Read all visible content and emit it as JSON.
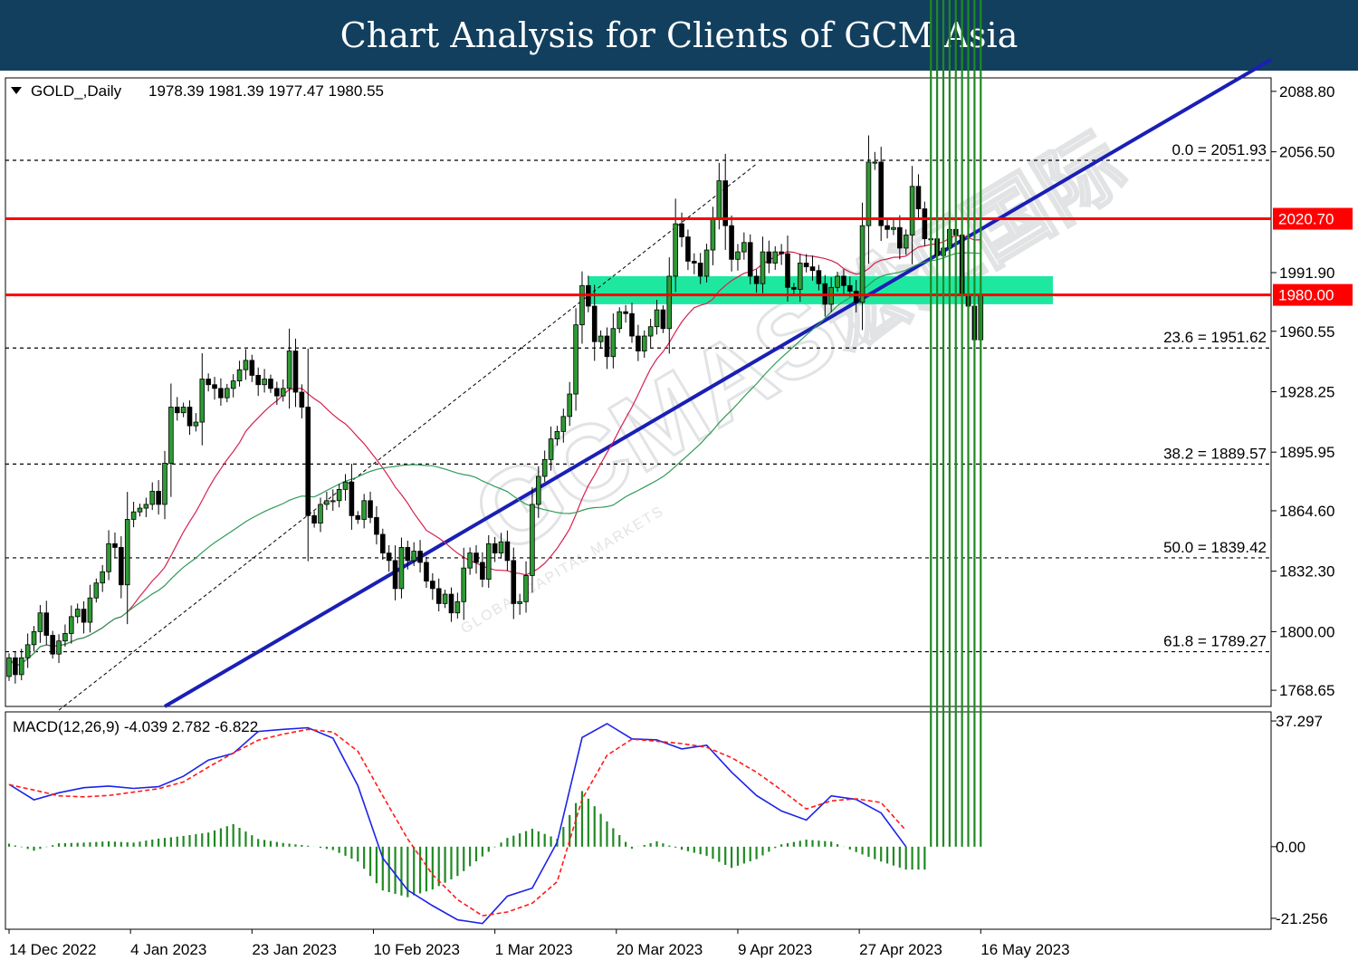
{
  "banner": {
    "title": "Chart Analysis for Clients of GCM Asia"
  },
  "watermark": {
    "brand": "GCMASIA",
    "chinese": "宏汇国际",
    "tagline": "GLOBAL CAPITAL MARKETS"
  },
  "colors": {
    "banner_bg": "#123f5e",
    "bull_candle": "#2e9a34",
    "bear_candle": "#000000",
    "ma_short": "#d8204f",
    "ma_long": "#2f9a58",
    "resistance": "#ff0000",
    "trendline": "#1a1fb5",
    "zone": "#1ee8a0",
    "macd_line": "#1b22e8",
    "macd_signal": "#ff1a1a",
    "macd_hist": "#1f8a22"
  },
  "chart_data": {
    "type": "candlestick",
    "symbol_header": "GOLD_,Daily",
    "ohlc_header": "1978.39 1981.39 1977.47 1980.55",
    "main_panel": {
      "ylim": [
        1760.0,
        2096.0
      ],
      "y_ticks": [
        "2088.80",
        "2056.50",
        "1991.90",
        "1960.55",
        "1928.25",
        "1895.95",
        "1864.60",
        "1832.30",
        "1800.00",
        "1768.65"
      ],
      "x_ticks": [
        "14 Dec 2022",
        "4 Jan 2023",
        "23 Jan 2023",
        "10 Feb 2023",
        "1 Mar 2023",
        "20 Mar 2023",
        "9 Apr 2023",
        "27 Apr 2023",
        "16 May 2023"
      ],
      "price_levels": [
        {
          "label": "2020.70",
          "value": 2020.7,
          "style": "solid-red"
        },
        {
          "label": "1980.00",
          "value": 1980.0,
          "style": "solid-red"
        }
      ],
      "fibonacci": [
        {
          "label": "0.0 = 2051.93",
          "value": 2051.93
        },
        {
          "label": "23.6 = 1951.62",
          "value": 1951.62
        },
        {
          "label": "38.2 = 1889.57",
          "value": 1889.57
        },
        {
          "label": "50.0 = 1839.42",
          "value": 1839.42
        },
        {
          "label": "61.8 = 1789.27",
          "value": 1789.27
        }
      ],
      "support_zone": [
        1975.0,
        1990.0
      ],
      "uptrend_line": [
        [
          25,
          1760
        ],
        [
          138,
          1980
        ]
      ],
      "dashed_channel": [
        [
          8,
          1758
        ],
        [
          120,
          2050
        ]
      ],
      "close": [
        1786,
        1777,
        1786,
        1793,
        1800,
        1810,
        1798,
        1788,
        1795,
        1799,
        1808,
        1812,
        1805,
        1818,
        1826,
        1832,
        1847,
        1845,
        1825,
        1860,
        1864,
        1866,
        1868,
        1875,
        1868,
        1890,
        1920,
        1917,
        1920,
        1910,
        1912,
        1935,
        1932,
        1930,
        1925,
        1930,
        1934,
        1940,
        1945,
        1937,
        1932,
        1935,
        1930,
        1926,
        1930,
        1950,
        1928,
        1920,
        1862,
        1858,
        1868,
        1870,
        1870,
        1876,
        1880,
        1862,
        1860,
        1870,
        1861,
        1852,
        1842,
        1838,
        1823,
        1845,
        1838,
        1843,
        1837,
        1827,
        1823,
        1815,
        1820,
        1810,
        1816,
        1834,
        1842,
        1837,
        1828,
        1847,
        1842,
        1848,
        1838,
        1815,
        1816,
        1830,
        1868,
        1883,
        1892,
        1903,
        1907,
        1915,
        1927,
        1964,
        1985,
        1974,
        1955,
        1958,
        1947,
        1962,
        1971,
        1970,
        1958,
        1950,
        1958,
        1963,
        1972,
        1962,
        1990,
        2018,
        2011,
        1998,
        1997,
        1990,
        2004,
        2021,
        2041,
        2017,
        1999,
        2003,
        2008,
        1990,
        1986,
        2003,
        1997,
        2003,
        2002,
        1984,
        1983,
        1997,
        1995,
        1993,
        1986,
        1975,
        1984,
        1990,
        1985,
        1982,
        1976,
        2017,
        2051,
        2051,
        2017,
        2015,
        2016,
        2005,
        2012,
        2038,
        2026,
        2010,
        2010,
        2001,
        2005,
        2015,
        2012,
        1980,
        1974,
        1956,
        1980
      ]
    },
    "macd_panel": {
      "header": "MACD(12,26,9) -4.039 2.782 -6.822",
      "ylim": [
        -24.5,
        40.0
      ],
      "y_ticks": [
        "37.297",
        "0.00",
        "-21.256"
      ],
      "macd": [
        18.5,
        13.9,
        16.0,
        17.5,
        18.0,
        17.3,
        17.8,
        20.9,
        25.7,
        27.7,
        34.2,
        34.8,
        35.3,
        32.2,
        18.1,
        -3.4,
        -12.9,
        -17.5,
        -21.7,
        -22.8,
        -14.7,
        -12.3,
        1.3,
        32.4,
        36.5,
        32.0,
        31.7,
        29.0,
        30.1,
        22.1,
        15.2,
        10.6,
        7.9,
        15.1,
        14.0,
        10.0,
        0.0
      ],
      "signal": [
        18.4,
        16.8,
        15.1,
        14.8,
        15.2,
        16.2,
        17.2,
        19.2,
        23.6,
        27.8,
        31.6,
        33.4,
        34.8,
        34.0,
        28.3,
        15.1,
        2.3,
        -8.3,
        -15.7,
        -20.5,
        -19.4,
        -16.8,
        -10.4,
        14.1,
        27.1,
        31.9,
        31.3,
        30.6,
        29.5,
        26.4,
        22.1,
        16.8,
        11.2,
        13.6,
        14.2,
        13.1,
        4.8
      ],
      "hist": [
        0.9,
        -1.2,
        1.0,
        1.2,
        1.6,
        1.2,
        2.4,
        3.2,
        4.2,
        6.7,
        2.3,
        1.1,
        0.3,
        -1.0,
        -4.4,
        -13.0,
        -15.0,
        -12.7,
        -8.7,
        -2.9,
        2.6,
        5.3,
        2.3,
        16.5,
        7.5,
        -0.6,
        1.6,
        -0.9,
        -2.7,
        -6.3,
        -3.7,
        0.7,
        2.1,
        1.5,
        -1.6,
        -4.4,
        -6.8
      ]
    }
  }
}
